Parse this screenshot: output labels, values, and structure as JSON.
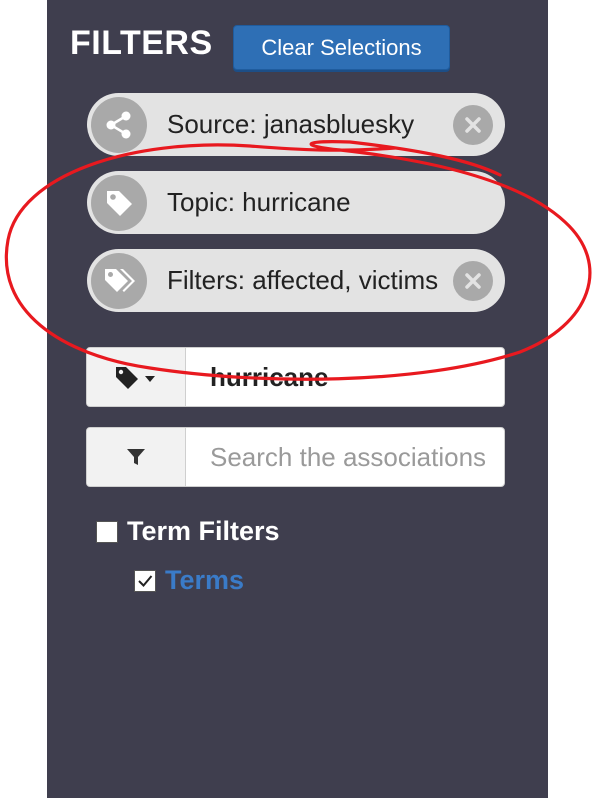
{
  "header": {
    "title": "FILTERS",
    "clear_button": "Clear Selections"
  },
  "pills": [
    {
      "icon": "share-icon",
      "label": "Source: janasbluesky",
      "removable": true
    },
    {
      "icon": "tag-icon",
      "label": "Topic: hurricane",
      "removable": false
    },
    {
      "icon": "tags-icon",
      "label": "Filters: affected, victims",
      "removable": true
    }
  ],
  "topic_input": {
    "icon": "tag-dropdown-icon",
    "value": "hurricane"
  },
  "filter_input": {
    "icon": "filter-icon",
    "placeholder": "Search the associations"
  },
  "tree": {
    "group_label": "Term Filters",
    "group_checked": false,
    "child_label": "Terms",
    "child_checked": true
  },
  "colors": {
    "panel_bg": "#3f3e4e",
    "accent_blue": "#2e6fb5",
    "annotation": "#e8191f",
    "link_blue": "#3a7bc8"
  }
}
